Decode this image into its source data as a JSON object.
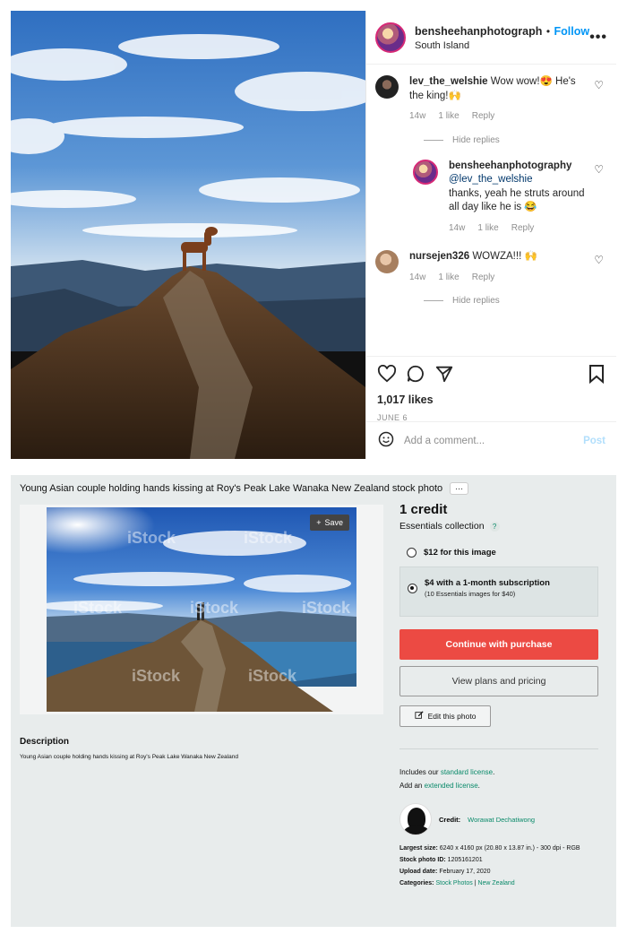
{
  "instagram": {
    "header": {
      "username": "bensheehanphotograph",
      "separator": "•",
      "follow_label": "Follow",
      "location": "South Island",
      "more_label": "•••"
    },
    "comments": [
      {
        "username": "lev_the_welshie",
        "text": "Wow wow!😍 He's the king!🙌",
        "time": "14w",
        "likes": "1 like",
        "reply_label": "Reply"
      },
      {
        "username": "bensheehanphotography",
        "mention": "@lev_the_welshie",
        "text": "thanks, yeah he struts around all day like he is 😂",
        "time": "14w",
        "likes": "1 like",
        "reply_label": "Reply"
      },
      {
        "username": "nursejen326",
        "text": "WOWZA!!! 🙌",
        "time": "14w",
        "likes": "1 like",
        "reply_label": "Reply"
      }
    ],
    "hide_replies_label": "Hide replies",
    "likes_count": "1,017 likes",
    "date": "JUNE 6",
    "comment_placeholder": "Add a comment...",
    "post_label": "Post"
  },
  "istock": {
    "title": "Young Asian couple holding hands kissing at Roy's Peak Lake Wanaka New Zealand stock photo",
    "more_label": "···",
    "save_label": "Save",
    "watermark": "iStock",
    "description_heading": "Description",
    "description_text": "Young Asian couple holding hands kissing at Roy's Peak Lake Wanaka New Zealand",
    "credit": "1 credit",
    "collection": "Essentials collection",
    "help_label": "?",
    "option1": "$12 for this image",
    "option2_main": "$4 with a 1-month subscription",
    "option2_sub": "(10 Essentials images for $40)",
    "continue_label": "Continue with purchase",
    "plans_label": "View plans and pricing",
    "edit_label": "Edit this photo",
    "license_prefix": "Includes our",
    "standard_license": "standard license",
    "add_prefix": "Add an",
    "extended_license": "extended license",
    "credit_label": "Credit:",
    "author": "Worawat Dechatiwong",
    "largest_size_label": "Largest size:",
    "largest_size": "6240 x 4160 px (20.80 x 13.87 in.) - 300 dpi - RGB",
    "stock_id_label": "Stock photo ID:",
    "stock_id": "1205161201",
    "upload_label": "Upload date:",
    "upload_date": "February 17, 2020",
    "categories_label": "Categories:",
    "category1": "Stock Photos",
    "category_sep": "|",
    "category2": "New Zealand"
  },
  "colors": {
    "instagram_blue": "#0095f6",
    "istock_red": "#ec4a43",
    "istock_green": "#0a8a6a"
  }
}
